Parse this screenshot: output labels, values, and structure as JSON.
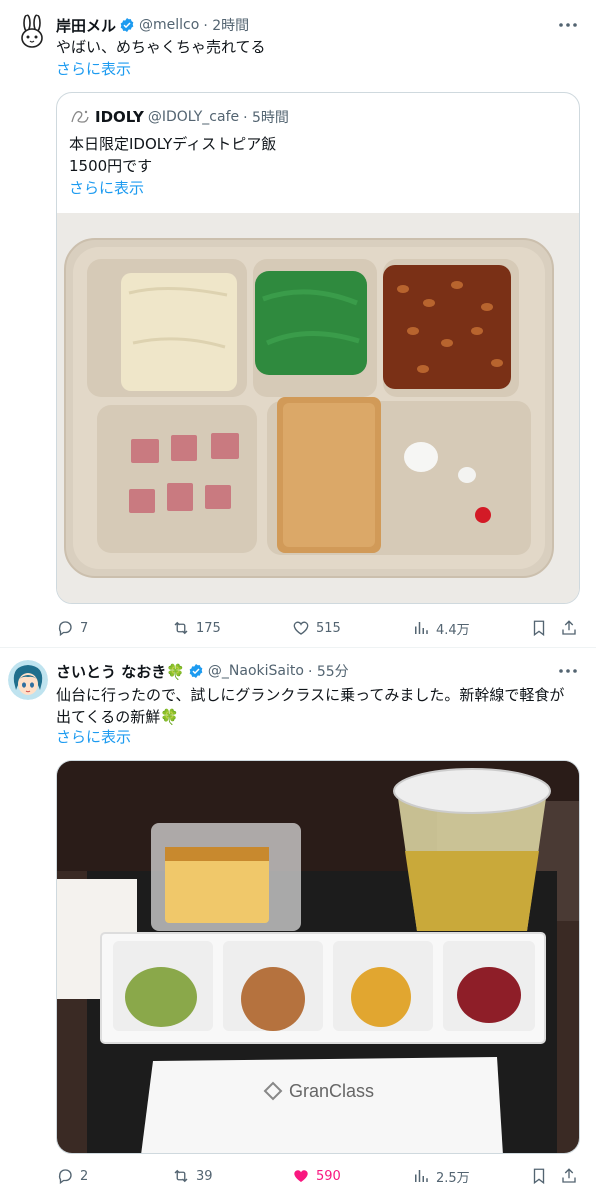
{
  "tweets": [
    {
      "name": "岸田メル",
      "handle": "@mellco",
      "time": "· 2時間",
      "text": "やばい、めちゃくちゃ売れてる",
      "show_more": "さらに表示",
      "quote": {
        "name": "IDOLY",
        "handle": "@IDOLY_cafe",
        "time": "· 5時間",
        "text_line1": "本日限定IDOLYディストピア飯",
        "text_line2": "1500円です",
        "show_more": "さらに表示"
      },
      "stats": {
        "replies": "7",
        "retweets": "175",
        "likes": "515",
        "views": "4.4万"
      }
    },
    {
      "name": "さいとう なおき🍀",
      "handle": "@_NaokiSaito",
      "time": "· 55分",
      "text_line1": "仙台に行ったので、試しにグランクラスに乗ってみました。新幹線で軽食が",
      "text_line2": "出てくるの新鮮🍀",
      "show_more": "さらに表示",
      "image_caption": "GranClass",
      "stats": {
        "replies": "2",
        "retweets": "39",
        "likes": "590",
        "views": "2.5万"
      }
    }
  ],
  "colors": {
    "accent": "#1d9bf0",
    "like": "#f91880",
    "muted": "#536471"
  },
  "icons": [
    "reply-icon",
    "retweet-icon",
    "like-icon",
    "views-icon",
    "bookmark-icon",
    "share-icon",
    "more-icon",
    "verified-icon"
  ]
}
